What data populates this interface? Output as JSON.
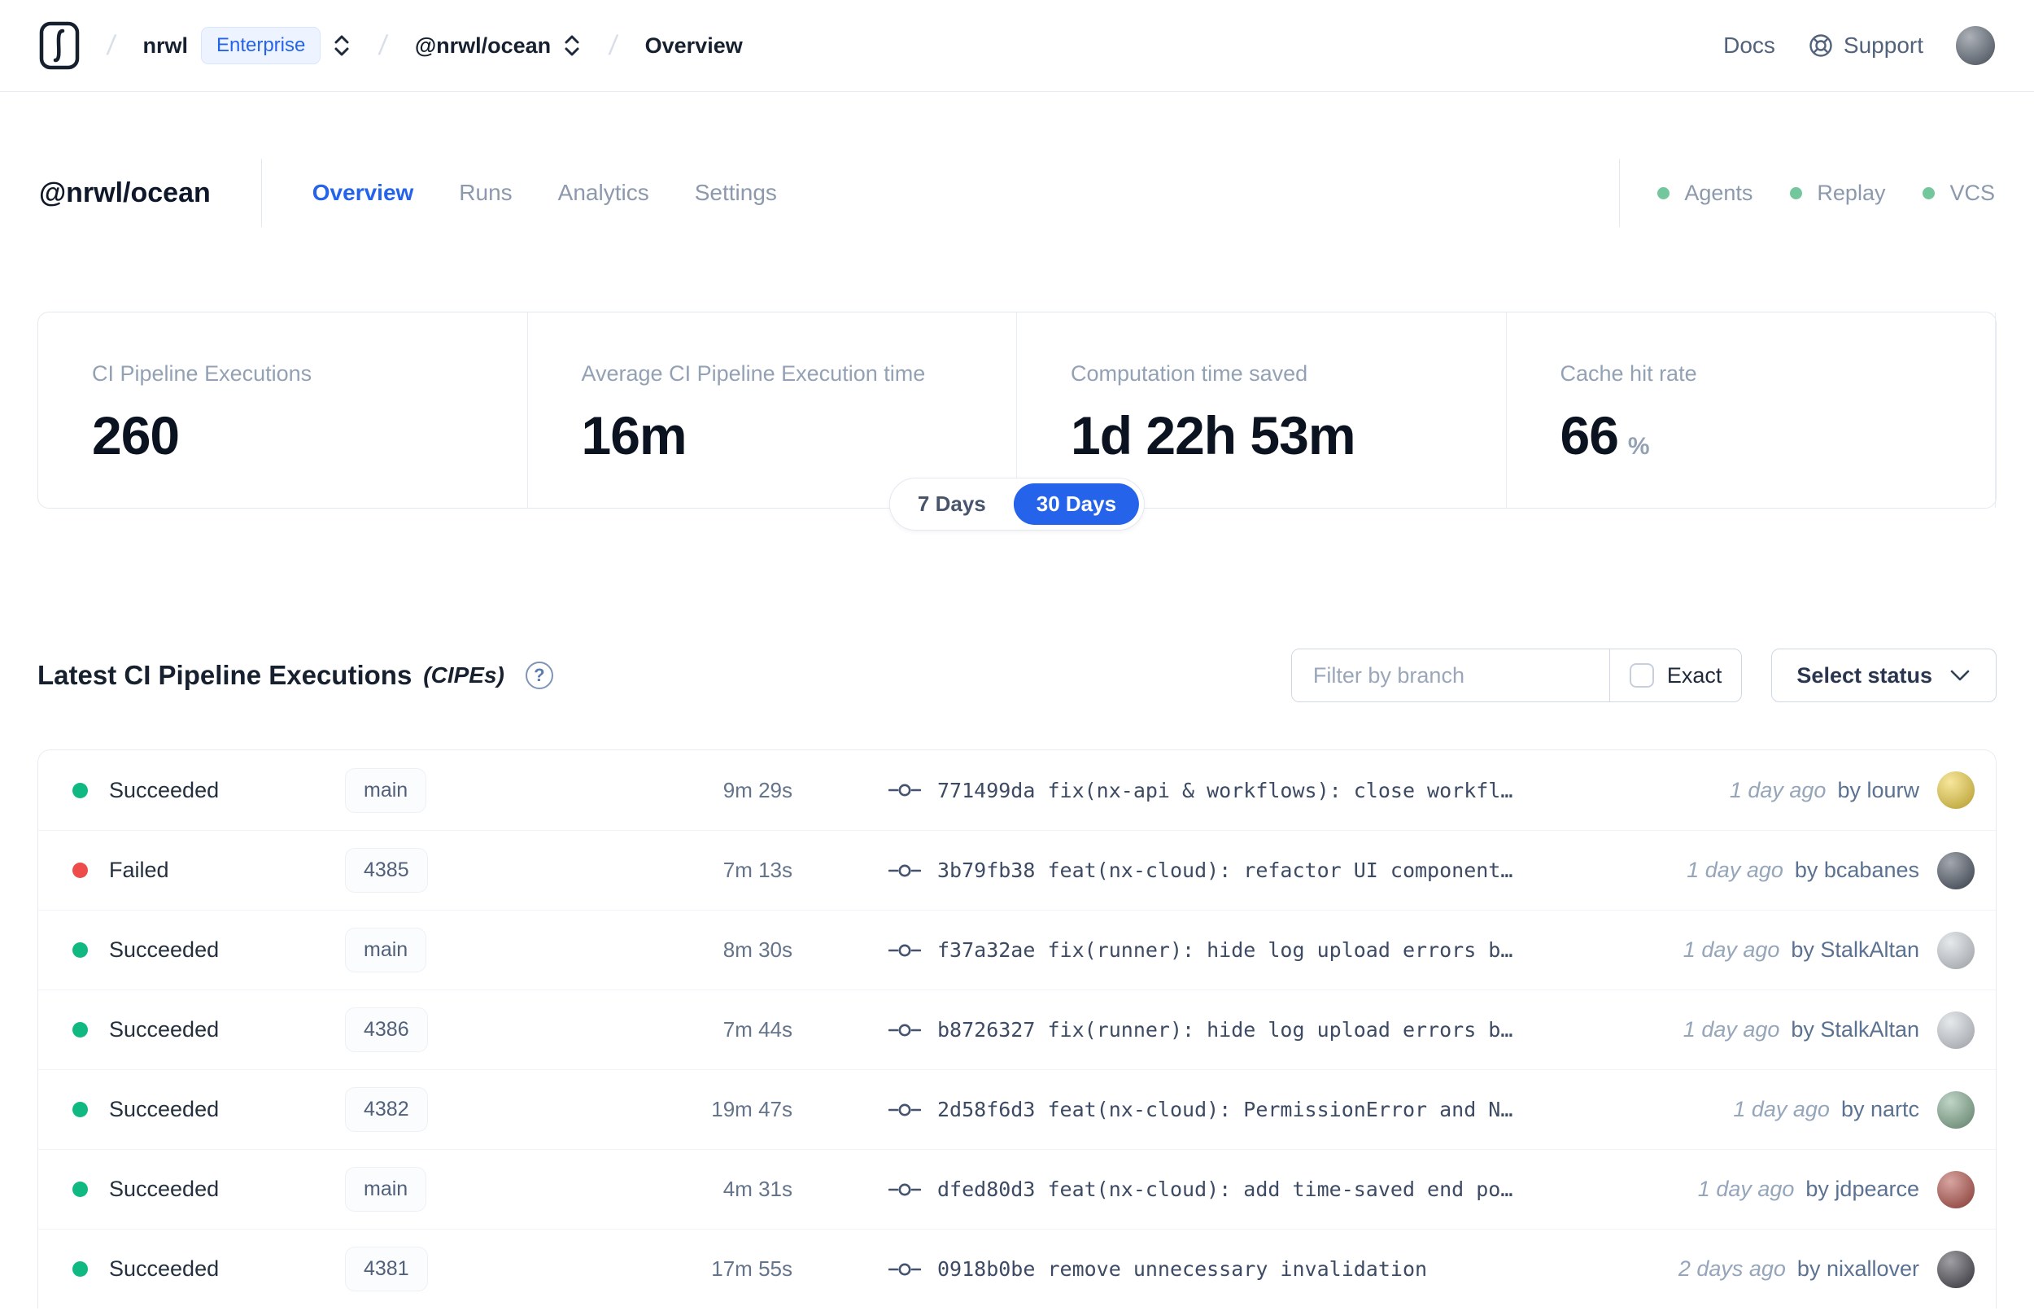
{
  "navbar": {
    "breadcrumb": {
      "separator": "/",
      "org": "nrwl",
      "org_badge": "Enterprise",
      "workspace": "@nrwl/ocean",
      "page": "Overview"
    },
    "docs_label": "Docs",
    "support_label": "Support"
  },
  "workspace": {
    "title": "@nrwl/ocean",
    "tabs": [
      {
        "label": "Overview"
      },
      {
        "label": "Runs"
      },
      {
        "label": "Analytics"
      },
      {
        "label": "Settings"
      }
    ],
    "features": [
      {
        "label": "Agents"
      },
      {
        "label": "Replay"
      },
      {
        "label": "VCS"
      }
    ]
  },
  "stats": {
    "cards": [
      {
        "label": "CI Pipeline Executions",
        "value": "260",
        "unit": ""
      },
      {
        "label": "Average CI Pipeline Execution time",
        "value": "16m",
        "unit": ""
      },
      {
        "label": "Computation time saved",
        "value": "1d 22h 53m",
        "unit": ""
      },
      {
        "label": "Cache hit rate",
        "value": "66",
        "unit": "%"
      }
    ],
    "range": {
      "seven": "7 Days",
      "thirty": "30 Days",
      "selected": "30 Days"
    }
  },
  "cipes": {
    "title": "Latest CI Pipeline Executions",
    "suffix": "(CIPEs)",
    "help_glyph": "?",
    "filter": {
      "placeholder": "Filter by branch",
      "exact": "Exact"
    },
    "status_select": "Select status",
    "rows": [
      {
        "status": "Succeeded",
        "status_color": "#10b981",
        "branch": "main",
        "duration": "9m 29s",
        "commit": "771499da fix(nx-api & workflows): close workfl…",
        "time": "1 day ago",
        "author": "by lourw",
        "avatar_color": "#f0cf3a"
      },
      {
        "status": "Failed",
        "status_color": "#ee4b4b",
        "branch": "4385",
        "duration": "7m 13s",
        "commit": "3b79fb38 feat(nx-cloud): refactor UI component…",
        "time": "1 day ago",
        "author": "by bcabanes",
        "avatar_color": "#46505e"
      },
      {
        "status": "Succeeded",
        "status_color": "#10b981",
        "branch": "main",
        "duration": "8m 30s",
        "commit": "f37a32ae fix(runner): hide log upload errors b…",
        "time": "1 day ago",
        "author": "by StalkAltan",
        "avatar_color": "#cdd3d9"
      },
      {
        "status": "Succeeded",
        "status_color": "#10b981",
        "branch": "4386",
        "duration": "7m 44s",
        "commit": "b8726327 fix(runner): hide log upload errors b…",
        "time": "1 day ago",
        "author": "by StalkAltan",
        "avatar_color": "#cdd3d9"
      },
      {
        "status": "Succeeded",
        "status_color": "#10b981",
        "branch": "4382",
        "duration": "19m 47s",
        "commit": "2d58f6d3 feat(nx-cloud): PermissionError and N…",
        "time": "1 day ago",
        "author": "by nartc",
        "avatar_color": "#7fa98c"
      },
      {
        "status": "Succeeded",
        "status_color": "#10b981",
        "branch": "main",
        "duration": "4m 31s",
        "commit": "dfed80d3 feat(nx-cloud): add time-saved end po…",
        "time": "1 day ago",
        "author": "by jdpearce",
        "avatar_color": "#b04a42"
      },
      {
        "status": "Succeeded",
        "status_color": "#10b981",
        "branch": "4381",
        "duration": "17m 55s",
        "commit": "0918b0be remove unnecessary invalidation",
        "time": "2 days ago",
        "author": "by nixallover",
        "avatar_color": "#3f3f48"
      }
    ]
  },
  "colors": {
    "accent_blue": "#2563eb",
    "success_green": "#10b981",
    "failed_red": "#ee4b4b",
    "feature_dot_green": "#74c69d",
    "navbar_avatar": "#5a6472"
  }
}
